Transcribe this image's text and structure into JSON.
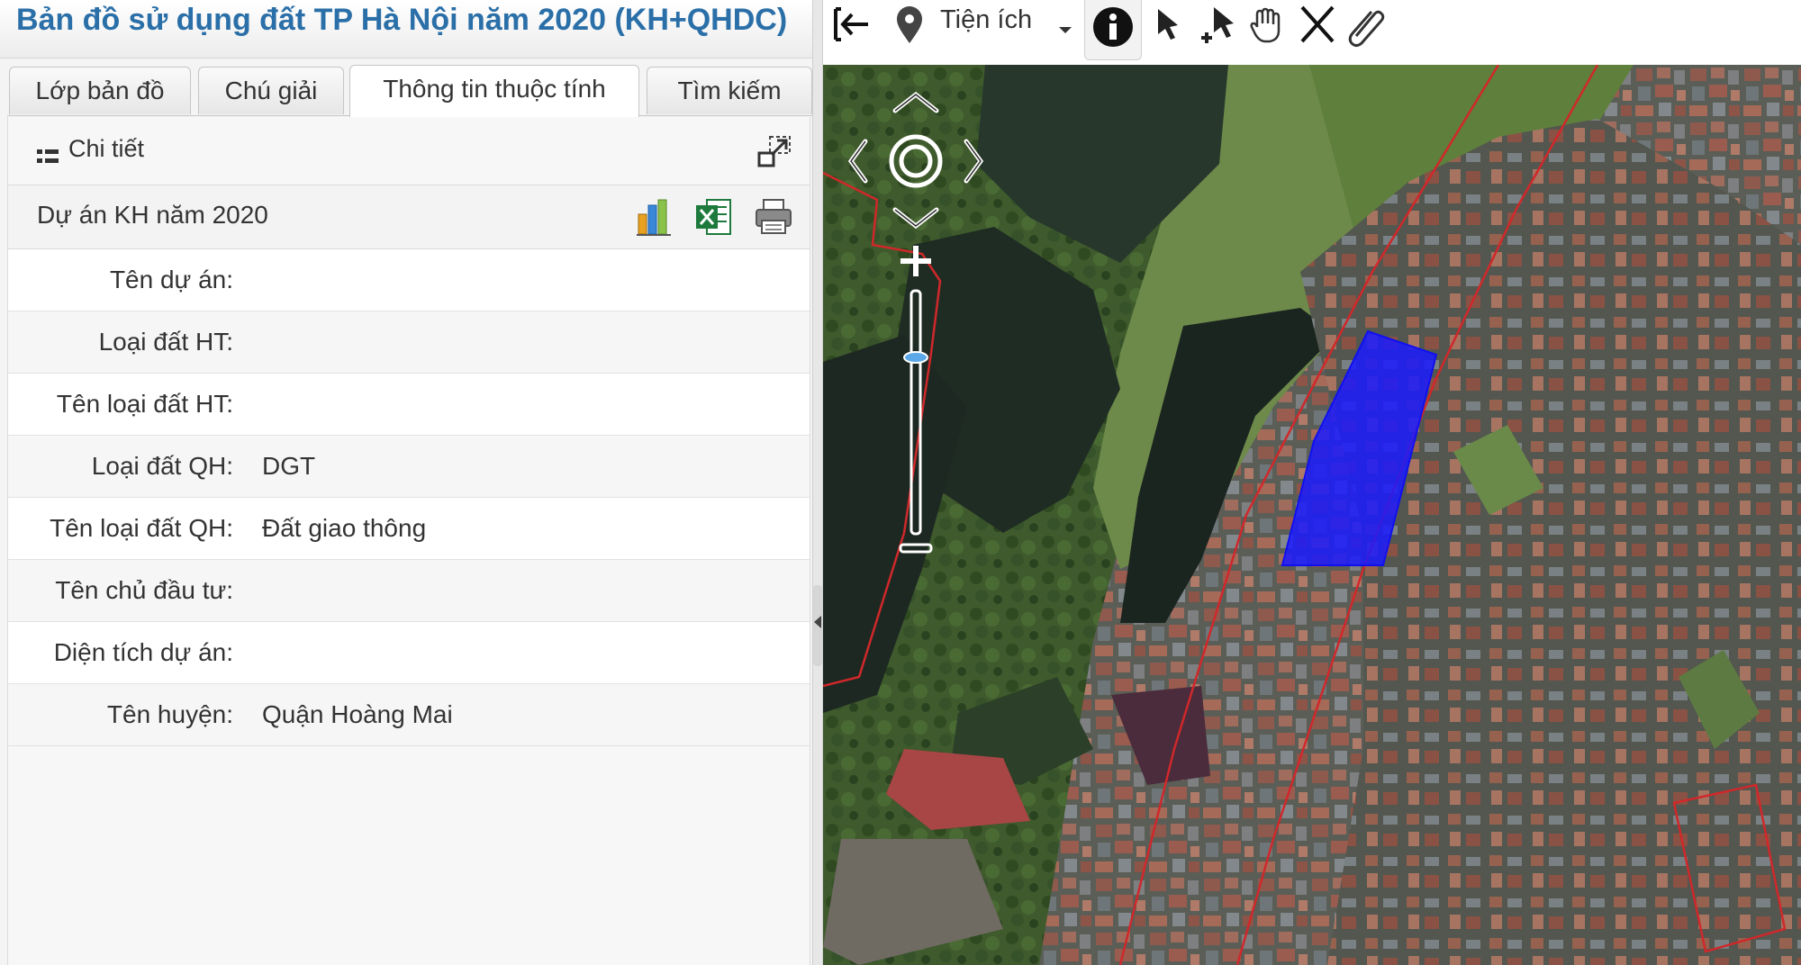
{
  "header": {
    "title": "Bản đồ sử dụng đất TP Hà Nội năm 2020 (KH+QHDC)"
  },
  "tabs": [
    {
      "label": "Lớp bản đồ"
    },
    {
      "label": "Chú giải"
    },
    {
      "label": "Thông tin thuộc tính",
      "active": true
    },
    {
      "label": "Tìm kiếm"
    }
  ],
  "detail": {
    "label": "Chi tiết"
  },
  "layer": {
    "title": "Dự án KH năm 2020"
  },
  "attributes": [
    {
      "label": "Tên dự án:",
      "value": ""
    },
    {
      "label": "Loại đất HT:",
      "value": ""
    },
    {
      "label": "Tên loại đất HT:",
      "value": ""
    },
    {
      "label": "Loại đất QH:",
      "value": "DGT"
    },
    {
      "label": "Tên loại đất QH:",
      "value": "Đất giao thông"
    },
    {
      "label": "Tên chủ đầu tư:",
      "value": ""
    },
    {
      "label": "Diện tích dự án:",
      "value": ""
    },
    {
      "label": "Tên huyện:",
      "value": "Quận Hoàng Mai"
    }
  ],
  "toolbar": {
    "tien_ich_label": "Tiện ích",
    "icons": [
      "exit-icon",
      "map-pin-icon",
      "dropdown-caret-icon",
      "info-icon",
      "select-arrow-icon",
      "add-point-icon",
      "pan-hand-icon",
      "clear-x-icon",
      "attach-icon"
    ]
  },
  "map": {
    "zoom_slider_level": 0.74,
    "highlight_color": "#1a1aff",
    "boundary_color": "#d0282a"
  },
  "colors": {
    "title": "#2a6fa8",
    "accent": "#2a6fa8"
  }
}
